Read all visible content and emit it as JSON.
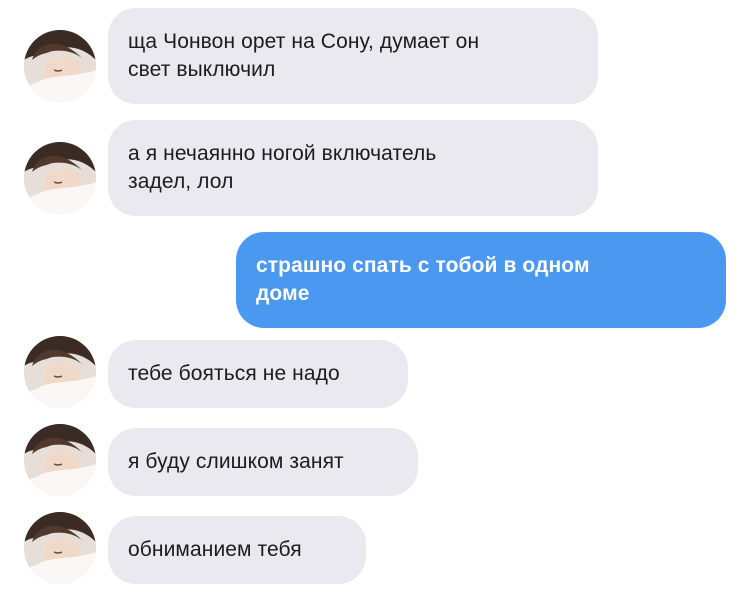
{
  "messages": [
    {
      "side": "in",
      "text": "ща Чонвон орет на Сону, думает он\nсвет выключил",
      "avatar": "user-avatar"
    },
    {
      "side": "in",
      "text": "а я нечаянно ногой включатель\nзадел, лол",
      "avatar": "user-avatar"
    },
    {
      "side": "out",
      "text": "страшно спать с тобой в одном\nдоме"
    },
    {
      "side": "in",
      "text": "тебе бояться не надо",
      "avatar": "user-avatar"
    },
    {
      "side": "in",
      "text": "я буду слишком занят",
      "avatar": "user-avatar"
    },
    {
      "side": "in",
      "text": "обниманием тебя",
      "avatar": "user-avatar"
    }
  ],
  "colors": {
    "incoming_bubble": "#e9e9ef",
    "outgoing_bubble": "#4a98ef",
    "incoming_text": "#1c1c1e",
    "outgoing_text": "#ffffff"
  }
}
